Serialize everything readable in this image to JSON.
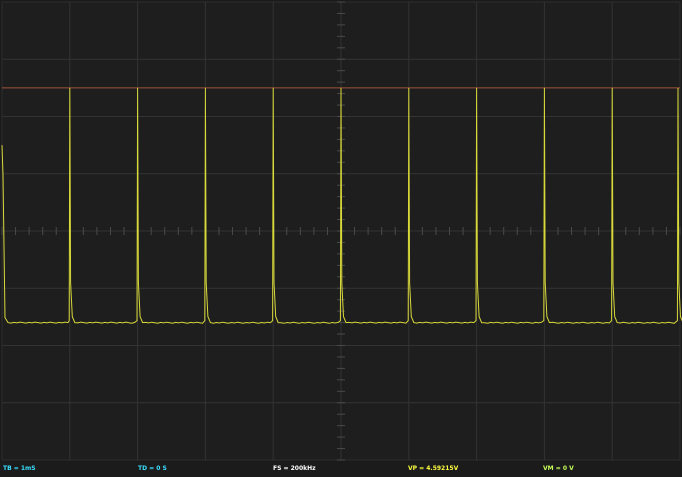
{
  "colors": {
    "background": "#1b1b1b",
    "screen": "#1e1e1e",
    "grid": "#333333",
    "axis_ticks": "#4a4a4a",
    "trace": "#d9d93a",
    "trigger_line": "#a0523a",
    "tb_color": "#39e0ff",
    "fs_color": "#ffffff",
    "vp_color": "#ffff40",
    "vm_color": "#c8ff5a"
  },
  "status_bar": {
    "timebase": "TB = 1mS",
    "trigger_delay": "TD = 0 S",
    "sample_rate": "FS = 200kHz",
    "v_peak": "VP = 4.59215V",
    "v_min": "VM = 0 V"
  },
  "chart_data": {
    "type": "line",
    "description_free": true,
    "xlim": [
      0,
      10
    ],
    "ylim": [
      -1,
      1
    ],
    "divisions": {
      "x": 10,
      "y": 8
    },
    "grid": true,
    "trigger_level_div": 2.5,
    "baseline_div": -1.6,
    "peaks": [
      {
        "t": 0.0,
        "level_div": 1.5
      },
      {
        "t": 1.0,
        "level_div": 2.5
      },
      {
        "t": 2.0,
        "level_div": 2.5
      },
      {
        "t": 3.0,
        "level_div": 2.5
      },
      {
        "t": 4.0,
        "level_div": 2.5
      },
      {
        "t": 5.0,
        "level_div": 2.5
      },
      {
        "t": 6.0,
        "level_div": 2.5
      },
      {
        "t": 7.0,
        "level_div": 2.5
      },
      {
        "t": 8.0,
        "level_div": 2.5
      },
      {
        "t": 9.0,
        "level_div": 2.5
      },
      {
        "t": 9.97,
        "level_div": 2.5
      }
    ]
  }
}
